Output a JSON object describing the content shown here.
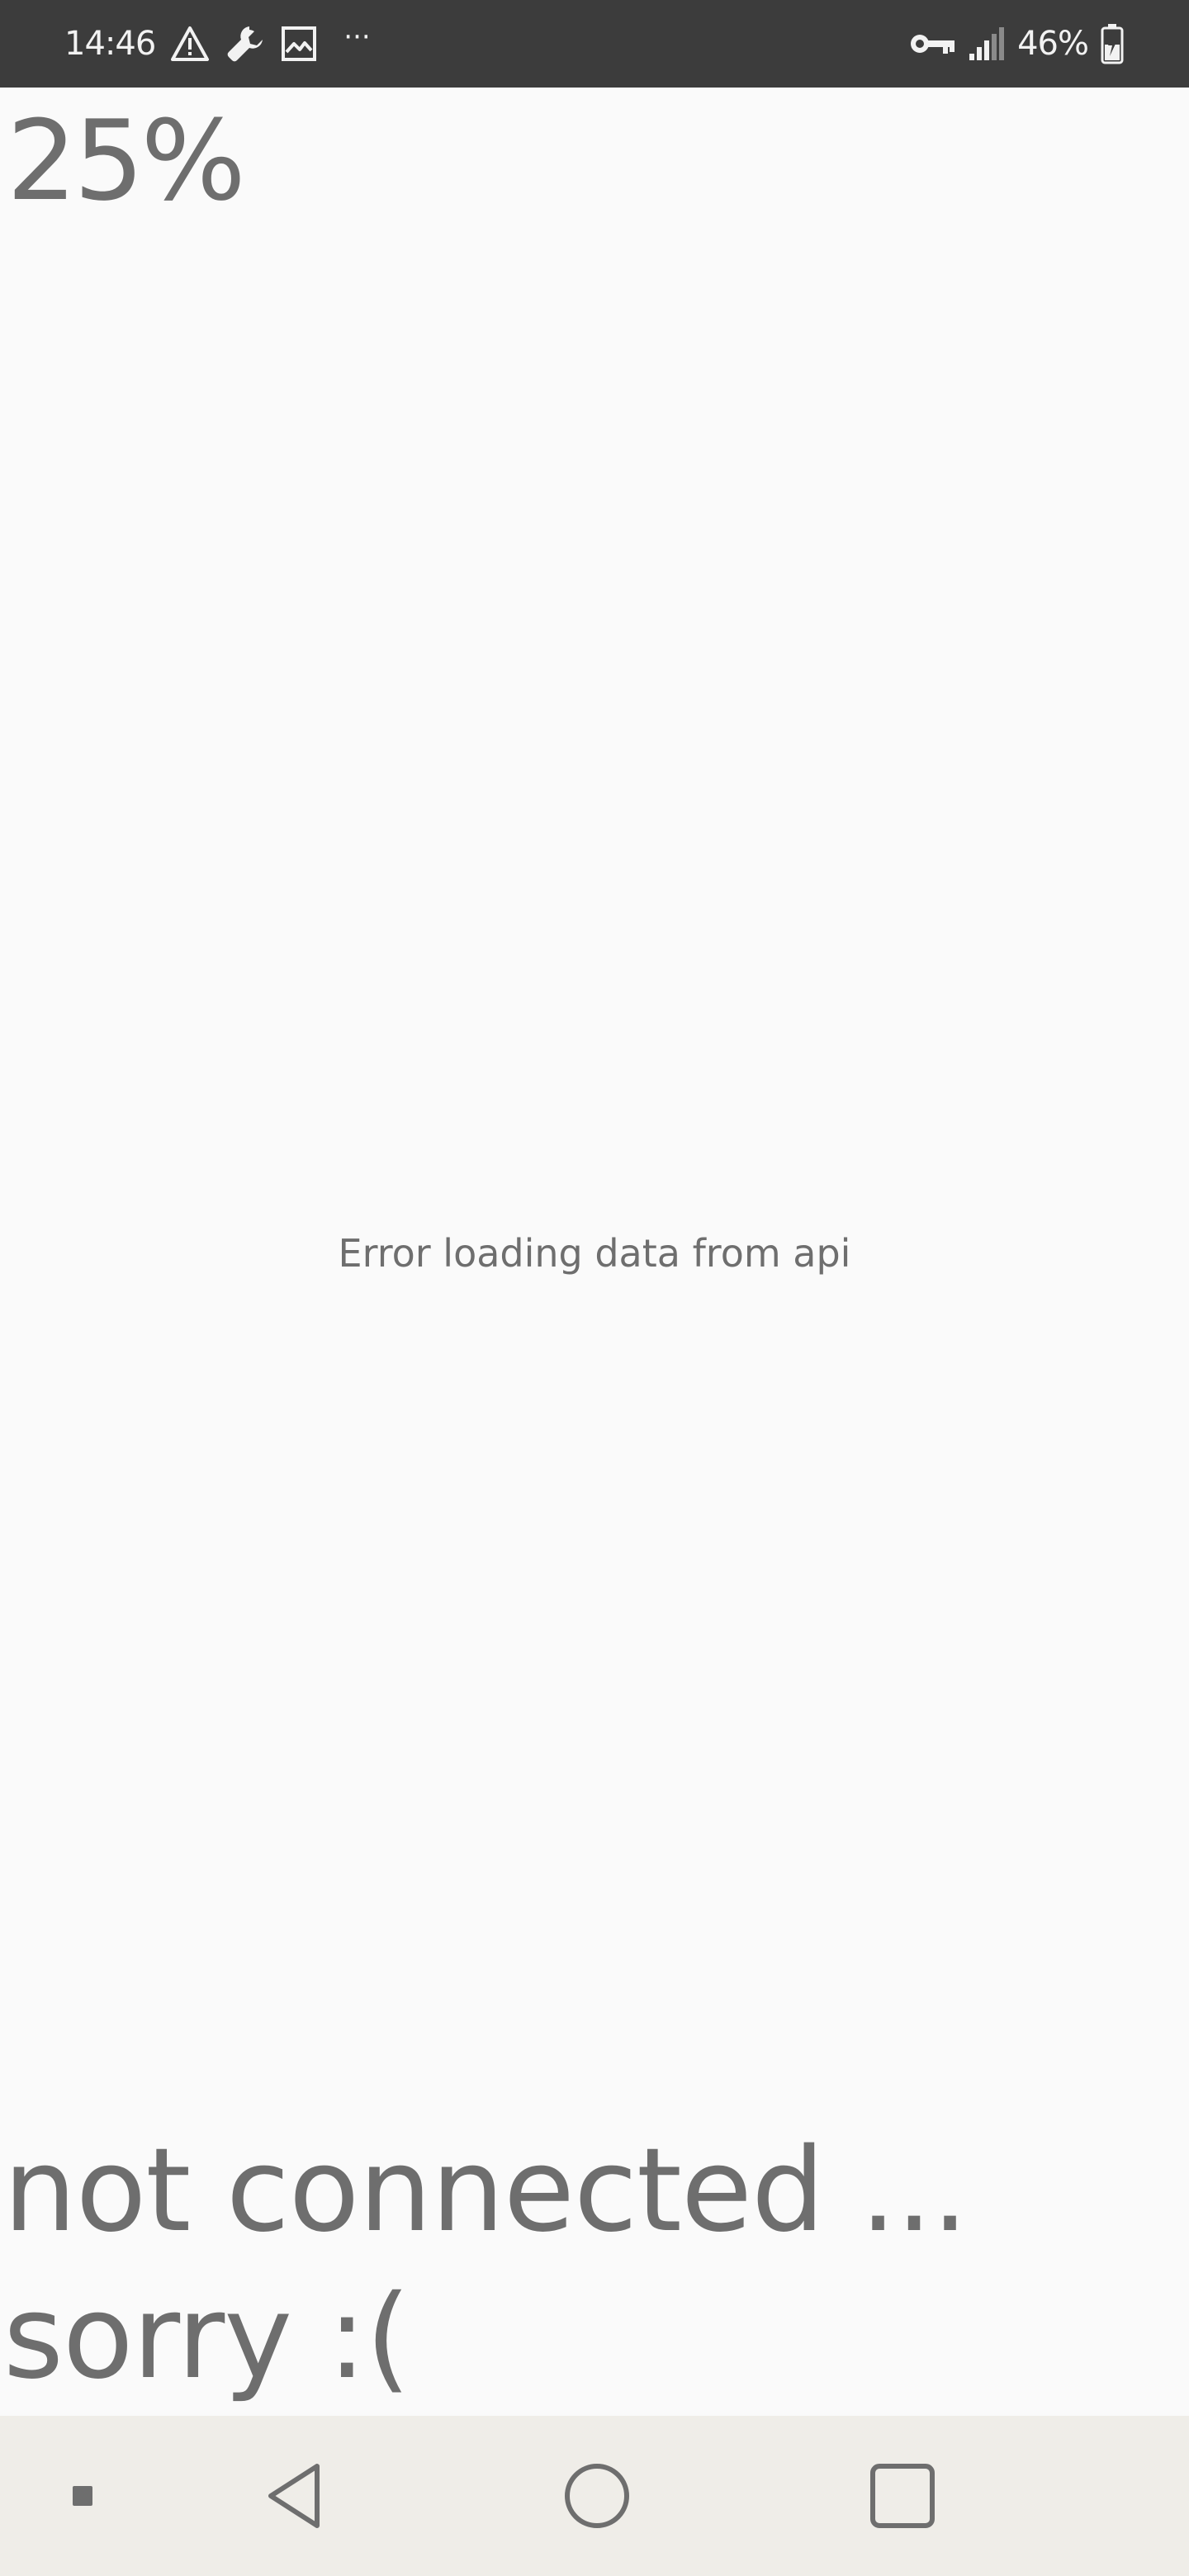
{
  "status_bar": {
    "time": "14:46",
    "left_icons": [
      "warning-icon",
      "wrench-icon",
      "image-icon"
    ],
    "more": "···",
    "right_icons": [
      "vpn-key-icon",
      "signal-icon",
      "battery-icon"
    ],
    "battery_percent": "46%"
  },
  "main": {
    "progress_label": "25%",
    "error_text": "Error loading data from api",
    "status_line1": "not connected ...",
    "status_line2": "sorry :("
  },
  "nav_bar": {
    "buttons": [
      "keyboard-indicator",
      "back",
      "home",
      "recents"
    ]
  },
  "colors": {
    "status_bar_bg": "#3c3c3c",
    "background": "#fafafa",
    "text": "#6e6e6e",
    "nav_bar_bg": "#efede8"
  }
}
